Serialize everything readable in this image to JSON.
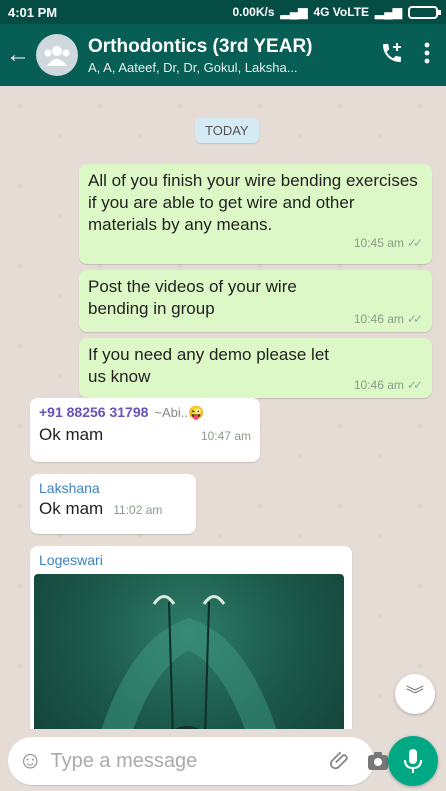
{
  "status_bar": {
    "time": "4:01 PM",
    "network": "0.00K/s",
    "carrier": "4G VoLTE"
  },
  "header": {
    "title": "Orthodontics (3rd YEAR)",
    "subtitle": "A, A, Aateef, Dr, Dr, Gokul, Laksha..."
  },
  "chat": {
    "date_label": "TODAY",
    "messages": [
      {
        "text": "All of you finish your wire bending exercises if you are able to get wire and other materials by any means.",
        "time": "10:45 am"
      },
      {
        "text": "Post the videos of your wire bending in group",
        "time": "10:46 am"
      },
      {
        "text": "If you need any demo please let us know",
        "time": "10:46 am"
      },
      {
        "sender": "+91 88256 31798",
        "sender_alias": "~Abi..😜",
        "text": "Ok mam",
        "time": "10:47 am"
      },
      {
        "sender": "Lakshana",
        "text": "Ok mam",
        "time": "11:02 am"
      },
      {
        "sender": "Logeswari"
      }
    ]
  },
  "composer": {
    "placeholder": "Type a message"
  },
  "colors": {
    "header": "#075e54",
    "outgoing": "#dcf8c6",
    "incoming": "#ffffff",
    "accent": "#00a884"
  }
}
